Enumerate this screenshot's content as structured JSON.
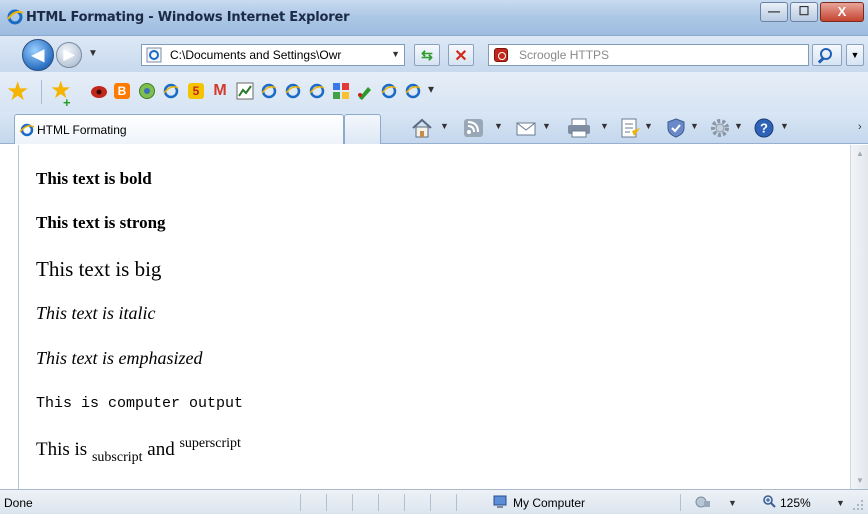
{
  "window": {
    "title": "HTML Formating - Windows Internet Explorer",
    "minimize_glyph": "—",
    "maximize_glyph": "☐",
    "close_glyph": "X"
  },
  "addressbar": {
    "url": "C:\\Documents and Settings\\Owr",
    "search_placeholder": "Scroogle HTTPS"
  },
  "favorites": {
    "items": [
      {
        "icon": "ie-page-icon"
      },
      {
        "icon": "gmail-icon",
        "text": "M"
      },
      {
        "icon": "five-icon",
        "text": "5"
      },
      {
        "icon": "blogger-icon",
        "text": "B"
      }
    ]
  },
  "tab": {
    "label": "HTML Formating"
  },
  "content": {
    "bold": "This text is bold",
    "strong": "This text is strong",
    "big": "This text is big",
    "italic": "This text is italic",
    "emphasized": "This text is emphasized",
    "computer_output": "This is computer output",
    "subsup_prefix": "This is ",
    "subscript": "subscript",
    "and": " and ",
    "superscript": "superscript"
  },
  "statusbar": {
    "status": "Done",
    "zone": "My Computer",
    "zoom": "125%"
  },
  "colors": {
    "titlebar": "#aec8e6",
    "accent": "#2a6fc2",
    "close_button": "#c4442f"
  }
}
